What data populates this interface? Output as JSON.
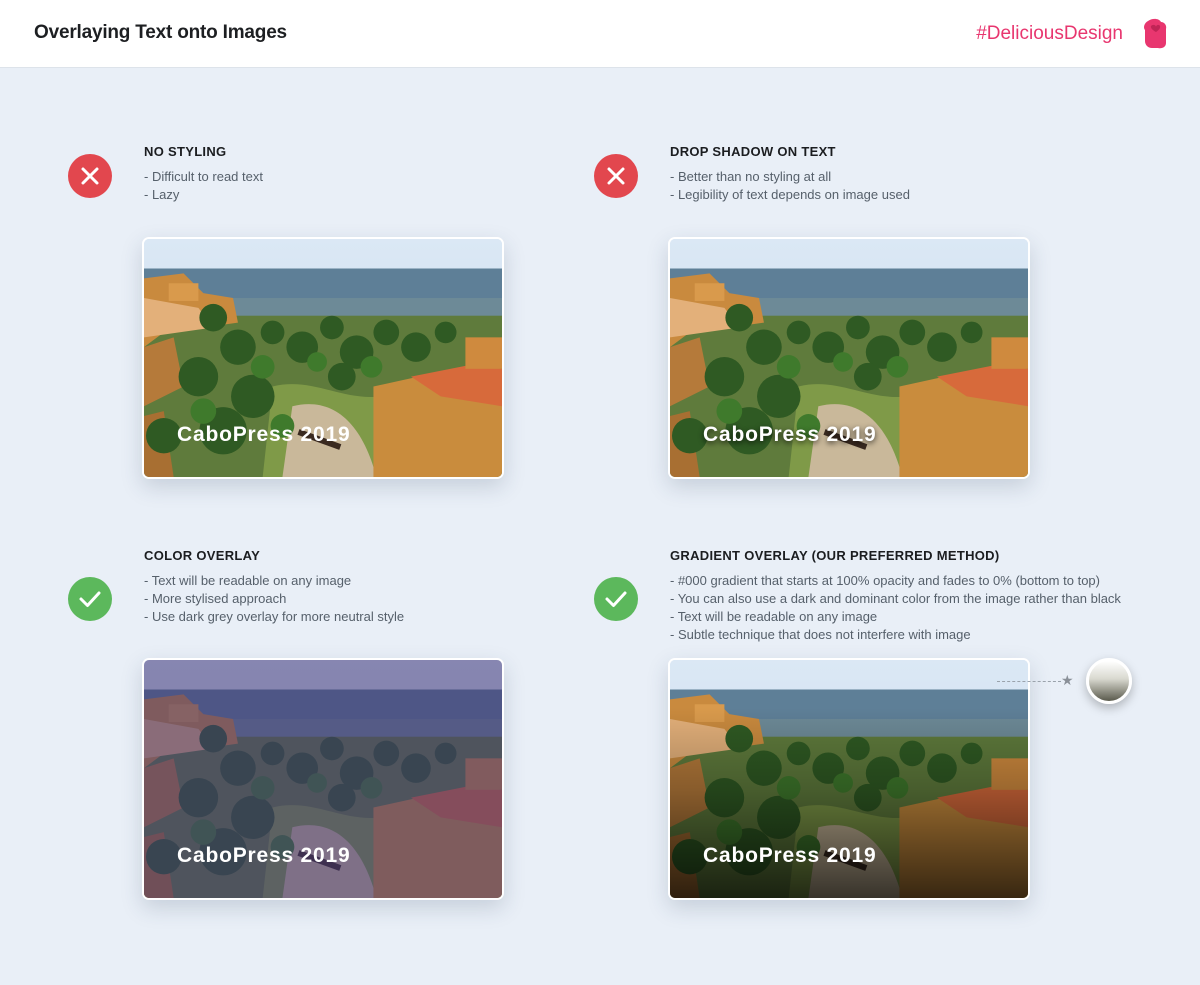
{
  "header": {
    "title": "Overlaying Text onto Images",
    "hashtag": "#DeliciousDesign",
    "brand_icon": "hand-heart-icon",
    "brand_color": "#e8366f"
  },
  "sections": [
    {
      "status": "bad",
      "status_icon": "cross-icon",
      "status_color": "#e2474e",
      "title": "NO STYLING",
      "lines": [
        "- Difficult to read text",
        "- Lazy"
      ],
      "caption": "CaboPress 2019"
    },
    {
      "status": "bad",
      "status_icon": "cross-icon",
      "status_color": "#e2474e",
      "title": "DROP SHADOW ON TEXT",
      "lines": [
        "- Better than no styling at all",
        "- Legibility of text depends on image used"
      ],
      "caption": "CaboPress 2019"
    },
    {
      "status": "good",
      "status_icon": "check-icon",
      "status_color": "#5cb85c",
      "title": "COLOR OVERLAY",
      "lines": [
        "- Text will be readable on any image",
        "- More stylised approach",
        "- Use dark grey overlay for more neutral style"
      ],
      "caption": "CaboPress 2019"
    },
    {
      "status": "good",
      "status_icon": "check-icon",
      "status_color": "#5cb85c",
      "title": "GRADIENT OVERLAY (OUR PREFERRED METHOD)",
      "lines": [
        "- #000 gradient that starts at 100% opacity and fades to 0% (bottom to top)",
        "- You can also use a dark and dominant color from the image rather than black",
        "- Text will be readable on any image",
        "- Subtle technique that does not interfere with image"
      ],
      "caption": "CaboPress 2019"
    }
  ],
  "gradient_picker": {
    "icon": "star-icon"
  }
}
